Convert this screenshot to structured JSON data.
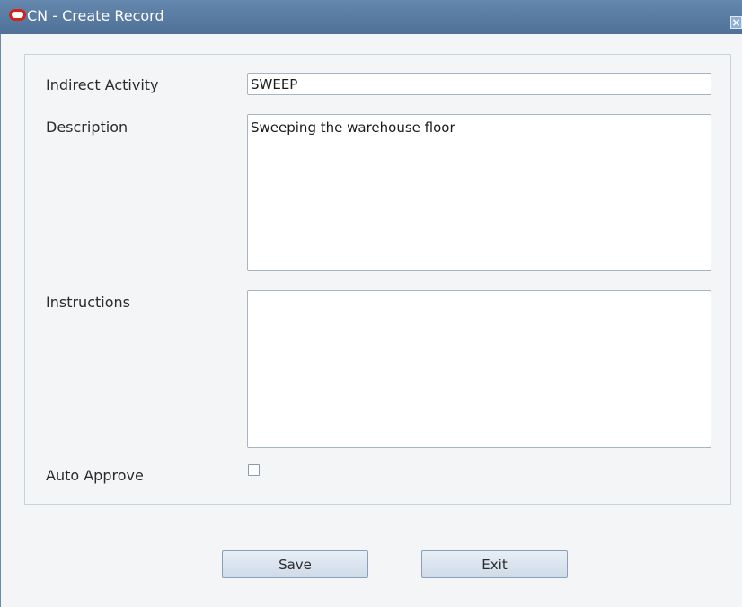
{
  "window": {
    "title": "CN - Create Record",
    "close_icon": "close-icon",
    "logo_icon": "oracle-logo-icon"
  },
  "form": {
    "indirect_activity": {
      "label": "Indirect Activity",
      "value": "SWEEP"
    },
    "description": {
      "label": "Description",
      "value": "Sweeping the warehouse floor"
    },
    "instructions": {
      "label": "Instructions",
      "value": ""
    },
    "auto_approve": {
      "label": "Auto Approve",
      "checked": false
    }
  },
  "buttons": {
    "save_label": "Save",
    "exit_label": "Exit"
  },
  "colors": {
    "titlebar": "#5a7ca3",
    "logo": "#d4221c",
    "background": "#f3f5f7",
    "button": "#dbe5ef"
  }
}
